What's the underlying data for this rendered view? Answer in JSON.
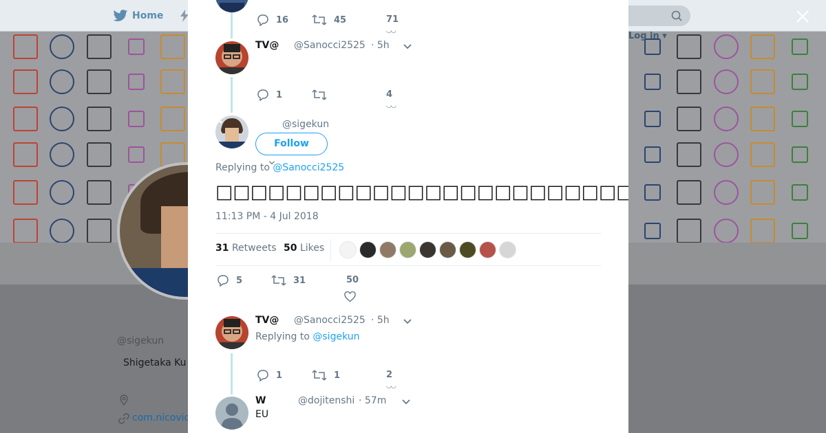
{
  "background": {
    "nav": {
      "home_label": "Home",
      "login_label": "Log in"
    },
    "profile": {
      "display_name": "",
      "handle": "@sigekun",
      "bio": "Shigetaka Ku",
      "url": "com.nicovid"
    }
  },
  "modal": {
    "tweets": [
      {
        "replies": "16",
        "retweets": "45",
        "likes": "71"
      },
      {
        "name": "TV@",
        "handle": "@Sanocci2525",
        "time": "· 5h",
        "replies": "1",
        "retweets": "",
        "likes": "4"
      }
    ],
    "main_tweet": {
      "name": "",
      "handle": "@sigekun",
      "follow_label": "Follow",
      "replying_label": "Replying to ",
      "replying_handle": "@Sanocci2525",
      "text": "□□□□□□□□□□□□□□□□□□□□□□□□□□□□□□□□□□□□□□□□□□□□□□□□□□□",
      "timestamp": "11:13 PM - 4 Jul 2018",
      "retweet_count": "31",
      "retweet_label": "Retweets",
      "like_count": "50",
      "like_label": "Likes",
      "replies": "5",
      "retweets": "31",
      "likes": "50"
    },
    "replies": [
      {
        "name": "TV@",
        "handle": "@Sanocci2525",
        "time": "· 5h",
        "replying_label": "Replying to ",
        "replying_handle": "@sigekun",
        "replies": "1",
        "retweets": "1",
        "likes": "2"
      },
      {
        "name": "W",
        "handle": "@dojitenshi",
        "time": "· 57m",
        "text": "EU"
      }
    ]
  },
  "colors": {
    "accent": "#1da1f2",
    "thread": "#bfe6ea",
    "muted": "#657786"
  }
}
